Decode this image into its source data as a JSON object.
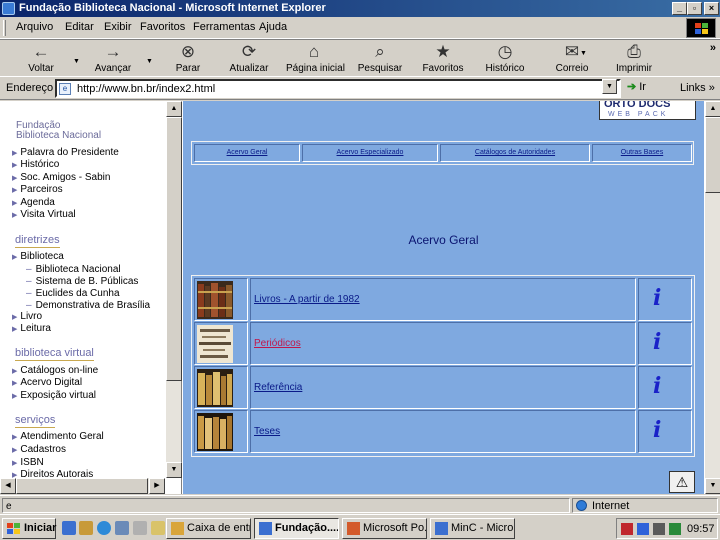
{
  "window": {
    "title": "Fundação Biblioteca Nacional - Microsoft Internet Explorer",
    "min_glyph": "_",
    "max_glyph": "▫",
    "close_glyph": "×"
  },
  "menu": [
    "Arquivo",
    "Editar",
    "Exibir",
    "Favoritos",
    "Ferramentas",
    "Ajuda"
  ],
  "toolbar": {
    "back": "Voltar",
    "forward": "Avançar",
    "stop": "Parar",
    "refresh": "Atualizar",
    "home": "Página inicial",
    "search": "Pesquisar",
    "favorites": "Favoritos",
    "history": "Histórico",
    "mail": "Correio",
    "print": "Imprimir",
    "icons": {
      "back": "←",
      "forward": "→",
      "stop": "⊗",
      "refresh": "⟳",
      "home": "⌂",
      "search": "⌕",
      "favorites": "★",
      "history": "◷",
      "mail": "✉",
      "print": "⎙"
    }
  },
  "address": {
    "label": "Endereço",
    "url": "http://www.bn.br/index2.html",
    "go": "Ir",
    "links": "Links",
    "chevron": "»"
  },
  "left_frame": {
    "title_line1": "Fundação",
    "title_line2": "Biblioteca Nacional",
    "top_items": [
      "Palavra do Presidente",
      "Histórico",
      "Soc. Amigos - Sabin",
      "Parceiros",
      "Agenda",
      "Visita Virtual"
    ],
    "diretrizes": {
      "heading": "diretrizes",
      "items": [
        "Biblioteca",
        "Livro",
        "Leitura"
      ],
      "subitems": [
        "Biblioteca Nacional",
        "Sistema de B. Públicas",
        "Euclides da Cunha",
        "Demonstrativa de Brasília"
      ]
    },
    "biblioteca_virtual": {
      "heading": "biblioteca virtual",
      "items": [
        "Catálogos on-line",
        "Acervo Digital",
        "Exposição virtual"
      ]
    },
    "servicos": {
      "heading": "serviços",
      "items": [
        "Atendimento Geral",
        "Cadastros",
        "ISBN",
        "Direitos Autorais"
      ]
    }
  },
  "main_frame": {
    "logo_top": "ORTO DOCS",
    "logo_bottom": "WEB PACK",
    "nav": [
      "Acervo Geral",
      "Acervo Especializado",
      "Catálogos de Autoridades",
      "Outras Bases"
    ],
    "section_title": "Acervo Geral",
    "rows": [
      {
        "label": "Livros - A partir de 1982",
        "visited": false
      },
      {
        "label": "Periódicos",
        "visited": true
      },
      {
        "label": "Referência",
        "visited": false
      },
      {
        "label": "Teses",
        "visited": false
      }
    ],
    "info_glyph": "i",
    "corner_glyph": "⚠"
  },
  "status": {
    "page_glyph": "e",
    "zone": "Internet"
  },
  "taskbar": {
    "start": "Iniciar",
    "tasks": [
      "Caixa de entr...",
      "Fundação....",
      "Microsoft Po...",
      "MinC - Micro..."
    ],
    "clock": "09:57"
  }
}
